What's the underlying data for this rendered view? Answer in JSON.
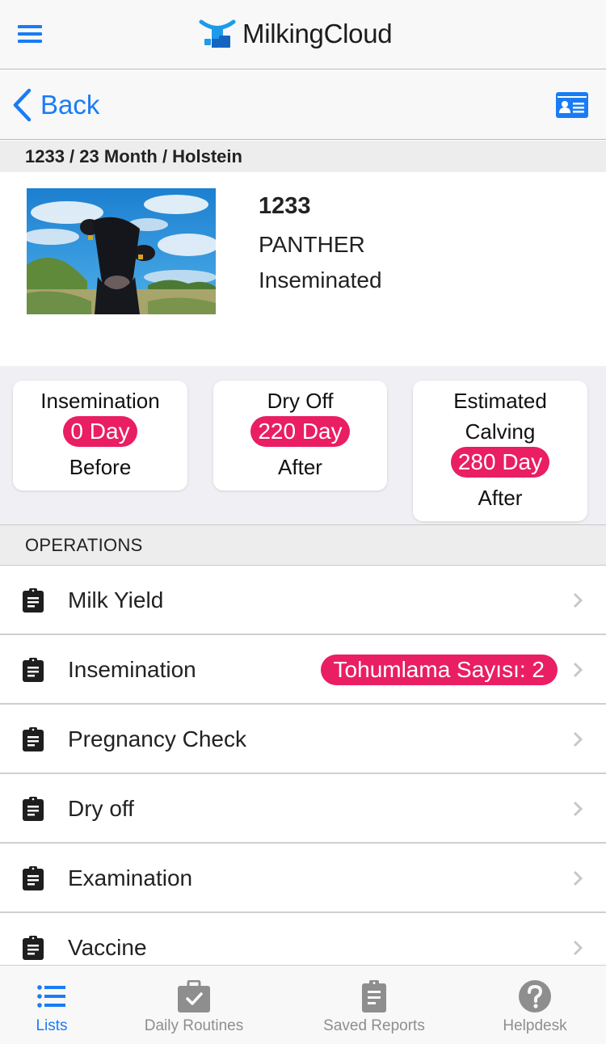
{
  "colors": {
    "accent": "#1a7cf5",
    "badge": "#e91e63",
    "inactive_tab": "#8e8e8e"
  },
  "header": {
    "app_name": "MilkingCloud",
    "menu_icon": "hamburger-menu-icon",
    "logo_icon": "milkingcloud-logo-icon"
  },
  "navbar": {
    "back_label": "Back",
    "back_icon": "chevron-left-icon",
    "card_icon": "id-card-icon"
  },
  "subheader": {
    "text": "1233 / 23 Month / Holstein"
  },
  "profile": {
    "photo": "black cow in a field under a blue sky with clouds",
    "id": "1233",
    "name": "PANTHER",
    "status": "Inseminated"
  },
  "stats": [
    {
      "title_line1": "Insemination",
      "title_line2": "",
      "value": "0 Day",
      "suffix": "Before"
    },
    {
      "title_line1": "Dry Off",
      "title_line2": "",
      "value": "220 Day",
      "suffix": "After"
    },
    {
      "title_line1": "Estimated",
      "title_line2": "Calving",
      "value": "280 Day",
      "suffix": "After"
    }
  ],
  "operations": {
    "header": "OPERATIONS",
    "items": [
      {
        "label": "Milk Yield",
        "badge": null,
        "icon": "clipboard-icon"
      },
      {
        "label": "Insemination",
        "badge": "Tohumlama Sayısı: 2",
        "icon": "clipboard-icon"
      },
      {
        "label": "Pregnancy Check",
        "badge": null,
        "icon": "clipboard-icon"
      },
      {
        "label": "Dry off",
        "badge": null,
        "icon": "clipboard-icon"
      },
      {
        "label": "Examination",
        "badge": null,
        "icon": "clipboard-icon"
      },
      {
        "label": "Vaccine",
        "badge": null,
        "icon": "clipboard-icon"
      }
    ]
  },
  "tabbar": {
    "tabs": [
      {
        "label": "Lists",
        "icon": "list-icon",
        "active": true
      },
      {
        "label": "Daily Routines",
        "icon": "clipboard-check-icon",
        "active": false
      },
      {
        "label": "Saved Reports",
        "icon": "clipboard-list-icon",
        "active": false
      },
      {
        "label": "Helpdesk",
        "icon": "question-circle-icon",
        "active": false
      }
    ]
  }
}
